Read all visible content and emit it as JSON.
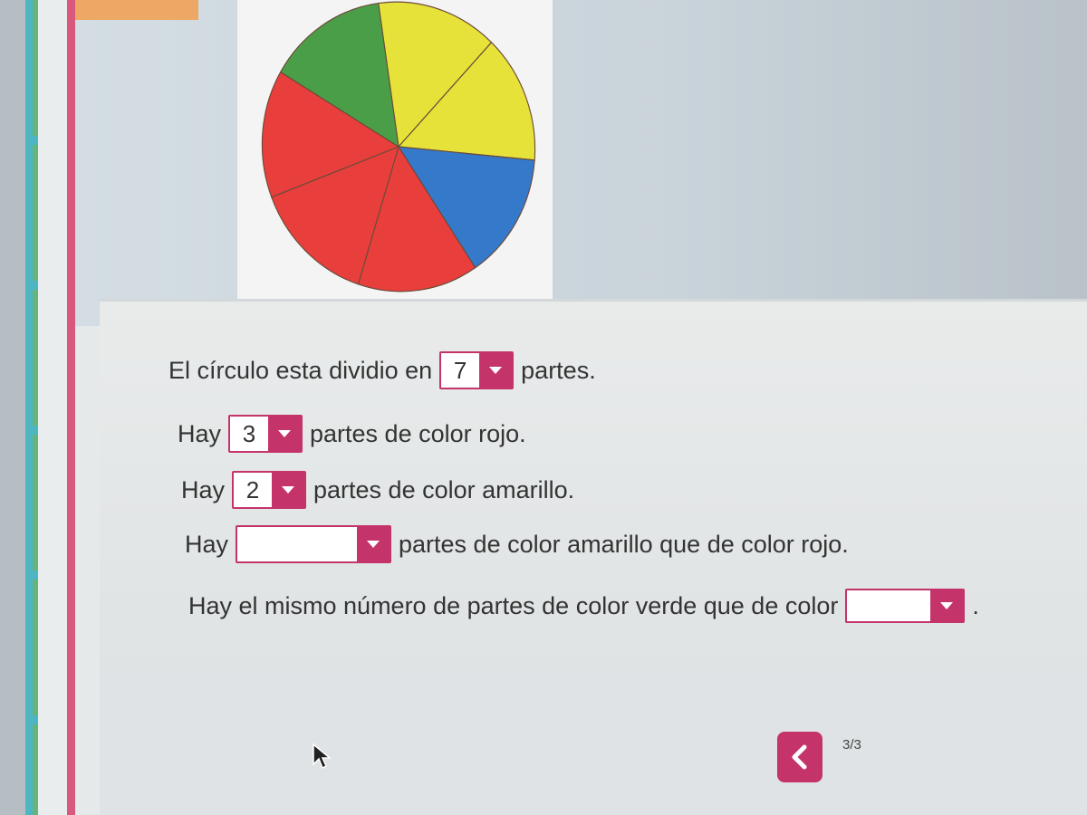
{
  "colors": {
    "accent": "#c5336b",
    "pie_red": "#e83f3c",
    "pie_yellow": "#e6e239",
    "pie_blue": "#3579cb",
    "pie_green": "#4b9e48"
  },
  "pie": {
    "slices": [
      {
        "color": "yellow"
      },
      {
        "color": "yellow"
      },
      {
        "color": "blue"
      },
      {
        "color": "red"
      },
      {
        "color": "red"
      },
      {
        "color": "red"
      },
      {
        "color": "green"
      }
    ]
  },
  "questions": {
    "q1": {
      "before": "El círculo esta dividio en",
      "value": "7",
      "after": "partes."
    },
    "q2": {
      "before": "Hay",
      "value": "3",
      "after": "partes de color rojo."
    },
    "q3": {
      "before": "Hay",
      "value": "2",
      "after": "partes de color amarillo."
    },
    "q4": {
      "before": "Hay",
      "value": "",
      "after": "partes de color amarillo que de color rojo."
    },
    "q5": {
      "before": "Hay el mismo número de partes de color verde que de color",
      "value": "",
      "after": "."
    }
  },
  "navigation": {
    "back_icon": "chevron-left-icon",
    "page_count": "3/3"
  },
  "cursor_icon": "mouse-pointer-icon"
}
